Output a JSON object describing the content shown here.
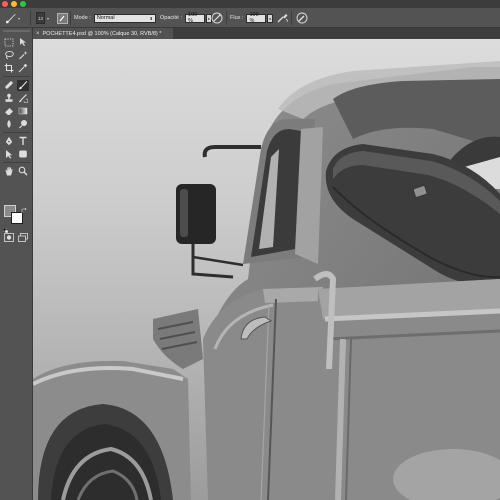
{
  "window": {
    "controls": [
      "close",
      "minimize",
      "zoom"
    ]
  },
  "options_bar": {
    "brush_size": "13",
    "mode_label": "Mode :",
    "mode_value": "Normal",
    "opacity_label": "Opacité :",
    "opacity_value": "100 %",
    "flow_label": "Flux :",
    "flow_value": "100 %"
  },
  "document_tab": {
    "close_glyph": "×",
    "title": "POCHETTE4.psd @ 100% (Calque 30, RVB/8) *"
  },
  "toolbar": {
    "tools": [
      "move-icon",
      "marquee-icon",
      "lasso-icon",
      "magic-wand-icon",
      "crop-icon",
      "eyedropper-icon",
      "healing-brush-icon",
      "brush-icon",
      "clone-stamp-icon",
      "history-brush-icon",
      "eraser-icon",
      "gradient-icon",
      "blur-icon",
      "dodge-icon",
      "pen-icon",
      "type-icon",
      "path-selection-icon",
      "shape-icon",
      "hand-icon",
      "zoom-icon",
      "quick-mask-icon",
      "screen-mode-icon"
    ],
    "active_tool": "brush-icon",
    "foreground_color": "#8a8a8a",
    "background_color": "#ffffff"
  },
  "canvas": {
    "content": "painting-grayscale-vintage-truck"
  }
}
